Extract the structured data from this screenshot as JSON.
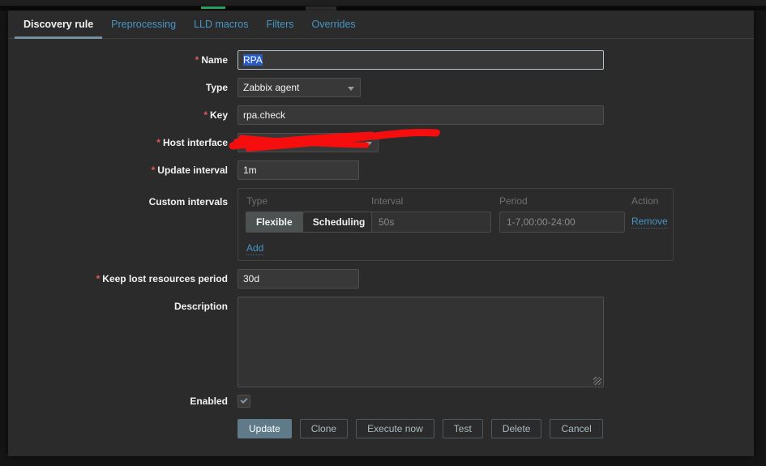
{
  "ui": {
    "required_marker": "*"
  },
  "tabs": [
    {
      "label": "Discovery rule",
      "active": true
    },
    {
      "label": "Preprocessing",
      "active": false
    },
    {
      "label": "LLD macros",
      "active": false
    },
    {
      "label": "Filters",
      "active": false
    },
    {
      "label": "Overrides",
      "active": false
    }
  ],
  "form": {
    "name": {
      "label": "Name",
      "required": true,
      "value": "RPA",
      "selected": true
    },
    "type": {
      "label": "Type",
      "value": "Zabbix agent"
    },
    "key": {
      "label": "Key",
      "required": true,
      "value": "rpa.check"
    },
    "host_interface": {
      "label": "Host interface",
      "required": true,
      "value": "",
      "redacted": true
    },
    "update_interval": {
      "label": "Update interval",
      "required": true,
      "value": "1m"
    },
    "custom_intervals": {
      "label": "Custom intervals",
      "headers": {
        "type": "Type",
        "interval": "Interval",
        "period": "Period",
        "action": "Action"
      },
      "row": {
        "type_options": [
          "Flexible",
          "Scheduling"
        ],
        "selected_type": "Flexible",
        "interval": "50s",
        "period": "1-7,00:00-24:00",
        "action_label": "Remove"
      },
      "add_label": "Add"
    },
    "keep_lost": {
      "label": "Keep lost resources period",
      "required": true,
      "value": "30d"
    },
    "description": {
      "label": "Description",
      "value": ""
    },
    "enabled": {
      "label": "Enabled",
      "checked": true
    }
  },
  "buttons": {
    "update": "Update",
    "clone": "Clone",
    "execute_now": "Execute now",
    "test": "Test",
    "delete": "Delete",
    "cancel": "Cancel"
  },
  "colors": {
    "accent_link": "#4796c4",
    "active_tab_underline": "#74909e",
    "required_red": "#e45959",
    "primary_button": "#5f7b8a",
    "selection_blue": "#2a5cc8",
    "redaction_red": "#f60d0d",
    "green_bar": "#2abc6e"
  }
}
